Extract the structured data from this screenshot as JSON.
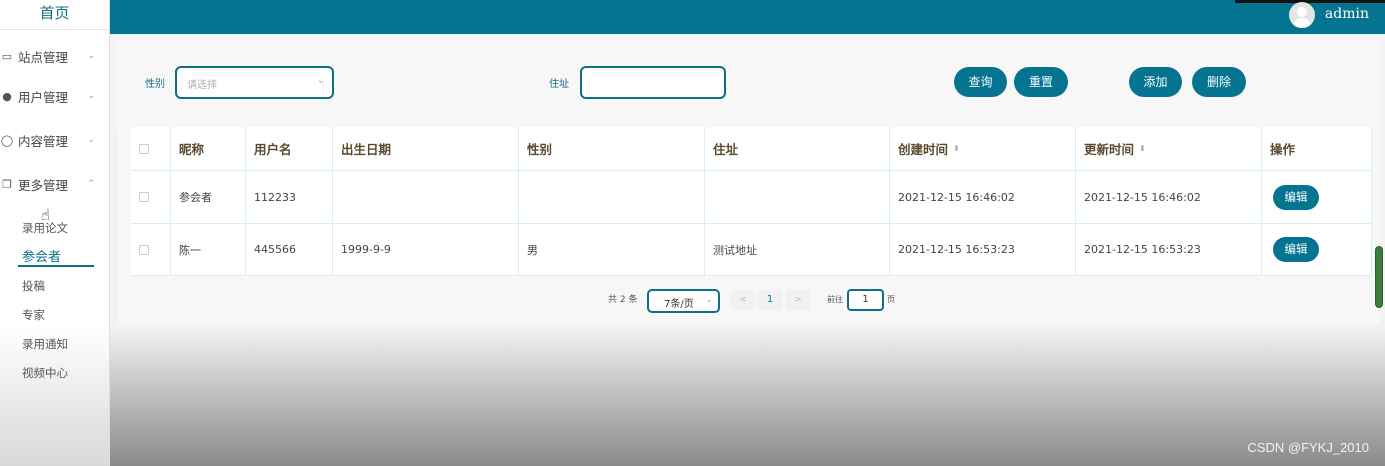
{
  "sidebar": {
    "brand": "首页",
    "groups": [
      {
        "label": "站点管理",
        "icon": "monitor-icon",
        "chevron": "⌄"
      },
      {
        "label": "用户管理",
        "icon": "user-icon",
        "chevron": "⌄"
      },
      {
        "label": "内容管理",
        "icon": "chat-icon",
        "chevron": "⌄"
      },
      {
        "label": "更多管理",
        "icon": "copy-icon",
        "chevron": "⌃"
      }
    ],
    "subitems": [
      "录用论文",
      "参会者",
      "投稿",
      "专家",
      "录用通知",
      "视频中心"
    ],
    "active_subitem": "参会者"
  },
  "header": {
    "username": "admin"
  },
  "search": {
    "gender_label": "性别",
    "gender_placeholder": "请选择",
    "address_label": "住址",
    "address_value": "",
    "buttons": {
      "query": "查询",
      "reset": "重置",
      "add": "添加",
      "delete": "删除"
    }
  },
  "table": {
    "headers": [
      "昵称",
      "用户名",
      "出生日期",
      "性别",
      "住址",
      "创建时间",
      "更新时间",
      "操作"
    ],
    "rows": [
      {
        "nickname": "参会者",
        "username": "112233",
        "birthdate": "",
        "gender": "",
        "address": "",
        "created": "2021-12-15 16:46:02",
        "updated": "2021-12-15 16:46:02",
        "action": "编辑"
      },
      {
        "nickname": "陈一",
        "username": "445566",
        "birthdate": "1999-9-9",
        "gender": "男",
        "address": "测试地址",
        "created": "2021-12-15 16:53:23",
        "updated": "2021-12-15 16:53:23",
        "action": "编辑"
      }
    ]
  },
  "pagination": {
    "total": "共 2 条",
    "page_size": "7条/页",
    "prev": "<",
    "current_page": "1",
    "next": ">",
    "goto_label": "前往",
    "goto_value": "1",
    "page_unit": "页"
  },
  "watermark": "CSDN @FYKJ_2010",
  "colors": {
    "primary": "#047490",
    "header": "#047490"
  }
}
